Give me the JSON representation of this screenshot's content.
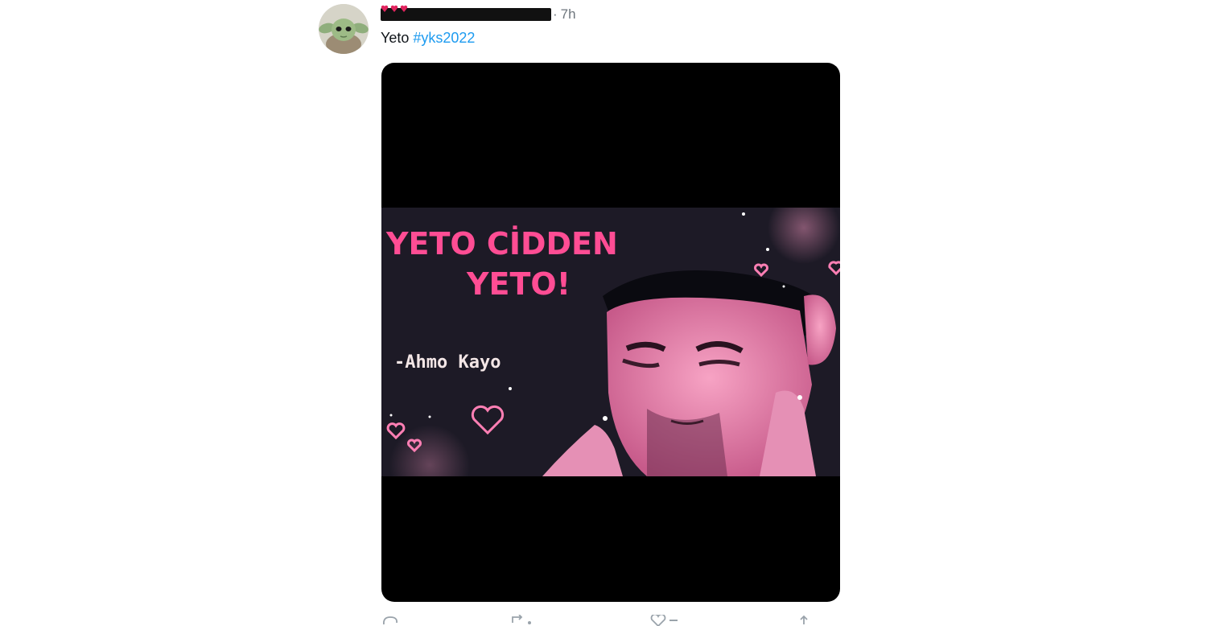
{
  "tweet": {
    "timestamp": "7h",
    "separator": "·",
    "text_plain": "Yeto ",
    "hashtag": "#yks2022",
    "avatar_icon": "baby-yoda-avatar",
    "redaction_icon": "emoji-hearts-icon"
  },
  "media": {
    "headline_line1": "YETO CİDDEN",
    "headline_line2": "YETO!",
    "attribution": "-Ahmo Kayo",
    "accent_color": "#ff4d94",
    "background_color": "#000000"
  },
  "actions": {
    "reply_icon": "reply-icon",
    "retweet_icon": "retweet-icon",
    "like_icon": "heart-icon",
    "share_icon": "share-icon"
  },
  "colors": {
    "text": "#0f1419",
    "secondary": "#6e767d",
    "link": "#1d9bf0"
  }
}
